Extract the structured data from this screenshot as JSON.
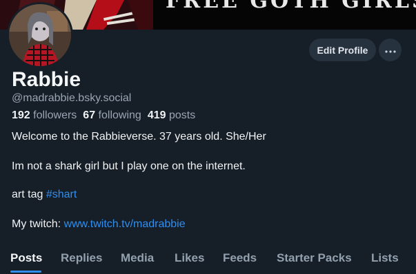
{
  "banner": {
    "text": "FREE GOTH GIRLS"
  },
  "profile": {
    "display_name": "Rabbie",
    "handle": "@madrabbie.bsky.social",
    "edit_label": "Edit Profile",
    "stats": {
      "followers_count": "192",
      "followers_label": "followers",
      "following_count": "67",
      "following_label": "following",
      "posts_count": "419",
      "posts_label": "posts"
    },
    "bio": {
      "line1": "Welcome to the Rabbieverse. 37 years old. She/Her",
      "line2": "Im not a shark girl but I play one on the internet.",
      "line3_prefix": "art tag ",
      "line3_tag": "#shart",
      "line4_prefix": "My twitch: ",
      "line4_link": "www.twitch.tv/madrabbie"
    }
  },
  "tabs": [
    "Posts",
    "Replies",
    "Media",
    "Likes",
    "Feeds",
    "Starter Packs",
    "Lists"
  ],
  "active_tab": "Posts",
  "colors": {
    "background": "#161e27",
    "accent": "#2e8ff0",
    "muted_text": "#9aa6b3",
    "button_bg": "#27323f"
  }
}
